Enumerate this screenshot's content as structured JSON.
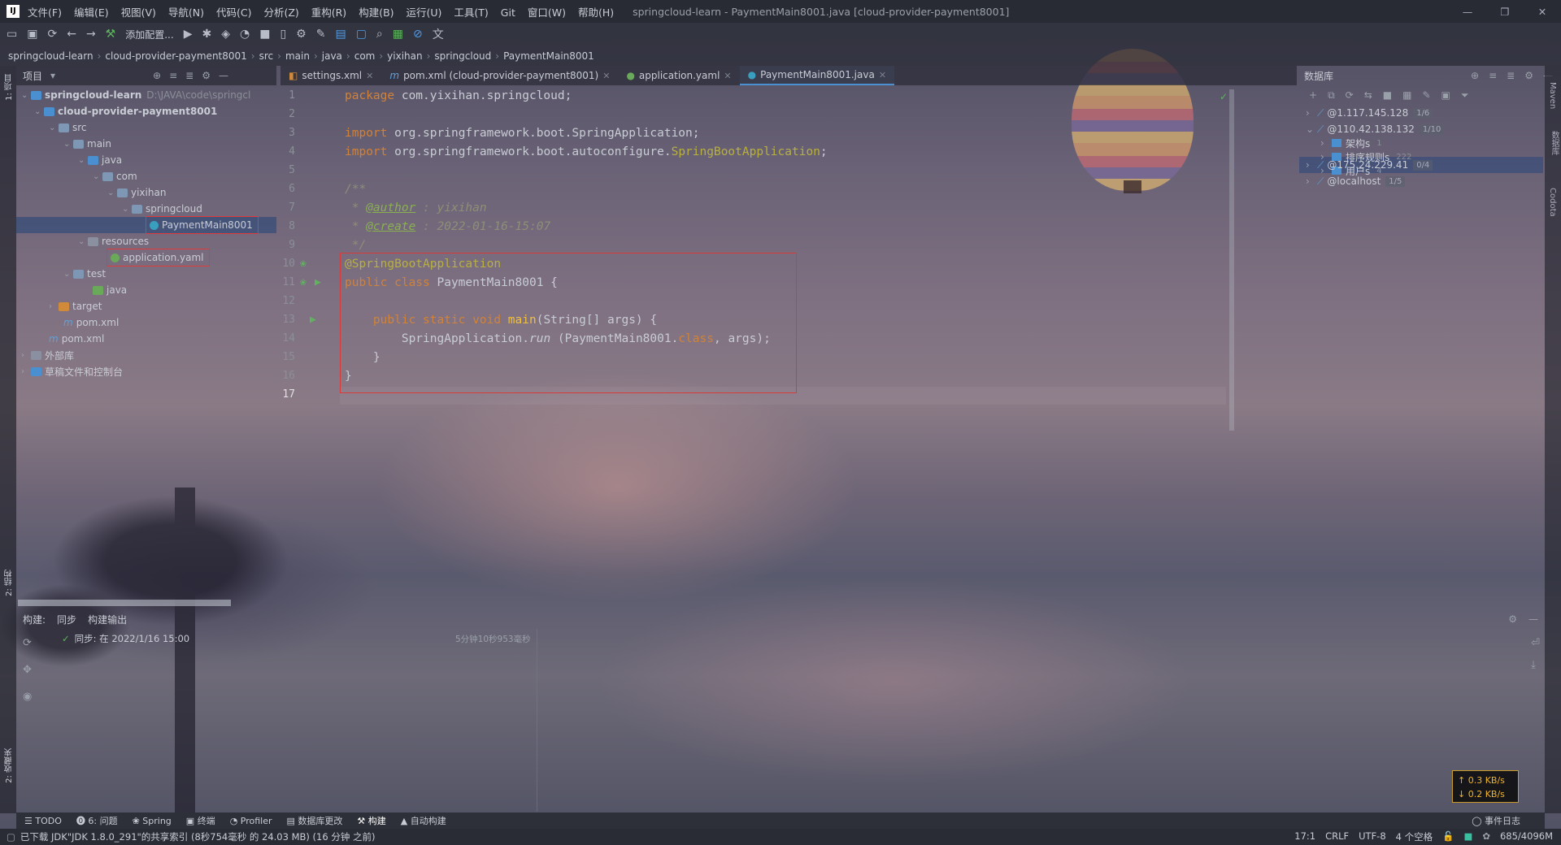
{
  "app": {
    "logo": "IJ",
    "menu": [
      "文件(F)",
      "编辑(E)",
      "视图(V)",
      "导航(N)",
      "代码(C)",
      "分析(Z)",
      "重构(R)",
      "构建(B)",
      "运行(U)",
      "工具(T)",
      "Git",
      "窗口(W)",
      "帮助(H)"
    ],
    "window_title": "springcloud-learn - PaymentMain8001.java [cloud-provider-payment8001]"
  },
  "toolbar": {
    "config_label": "添加配置..."
  },
  "breadcrumb": [
    "springcloud-learn",
    "cloud-provider-payment8001",
    "src",
    "main",
    "java",
    "com",
    "yixihan",
    "springcloud",
    "PaymentMain8001"
  ],
  "project": {
    "title": "项目",
    "tree": [
      {
        "label": "springcloud-learn",
        "path": "D:\\JAVA\\code\\springcl",
        "bold": true
      },
      {
        "label": "cloud-provider-payment8001",
        "bold": true
      },
      {
        "label": "src"
      },
      {
        "label": "main"
      },
      {
        "label": "java"
      },
      {
        "label": "com"
      },
      {
        "label": "yixihan"
      },
      {
        "label": "springcloud"
      },
      {
        "label": "PaymentMain8001"
      },
      {
        "label": "resources"
      },
      {
        "label": "application.yaml"
      },
      {
        "label": "test"
      },
      {
        "label": "java"
      },
      {
        "label": "target"
      },
      {
        "label": "pom.xml"
      },
      {
        "label": "pom.xml"
      },
      {
        "label": "外部库"
      },
      {
        "label": "草稿文件和控制台"
      }
    ]
  },
  "tabs": [
    {
      "label": "settings.xml"
    },
    {
      "label": "pom.xml (cloud-provider-payment8001)"
    },
    {
      "label": "application.yaml"
    },
    {
      "label": "PaymentMain8001.java",
      "active": true
    }
  ],
  "editor": {
    "line_numbers": [
      "1",
      "2",
      "3",
      "4",
      "5",
      "6",
      "7",
      "8",
      "9",
      "10",
      "11",
      "12",
      "13",
      "14",
      "15",
      "16",
      "17"
    ],
    "code": {
      "l1_kw": "package",
      "l1_rest": " com.yixihan.springcloud;",
      "l3_kw": "import",
      "l3_rest": " org.springframework.boot.SpringApplication;",
      "l4_kw": "import",
      "l4_rest": " org.springframework.boot.autoconfigure.",
      "l4_cls": "SpringBootApplication",
      "l4_end": ";",
      "l6": "/**",
      "l7_pre": " * ",
      "l7_tag": "@author",
      "l7_rest": " : yixihan",
      "l8_pre": " * ",
      "l8_tag": "@create",
      "l8_rest": " : 2022-01-16-15:07",
      "l9": " */",
      "l10": "@SpringBootApplication",
      "l11_kw": "public class",
      "l11_rest": " PaymentMain8001 {",
      "l13_ind": "    ",
      "l13_kw": "public static void",
      "l13_fn": " main",
      "l13_rest": "(String[] args) {",
      "l14_ind": "        ",
      "l14_a": "SpringApplication.",
      "l14_run": "run",
      "l14_b": " (PaymentMain8001.",
      "l14_cls": "class",
      "l14_c": ", args);",
      "l15": "    }",
      "l16": "}"
    }
  },
  "database": {
    "title": "数据库",
    "items": [
      {
        "label": "@1.117.145.128",
        "count": "1/6"
      },
      {
        "label": "@110.42.138.132",
        "count": "1/10"
      },
      {
        "label": "架构s",
        "n": "1"
      },
      {
        "label": "排序规则s",
        "n": "222"
      },
      {
        "label": "用户s",
        "n": "4"
      },
      {
        "label": "@175.24.229.41",
        "count": "0/4"
      },
      {
        "label": "@localhost",
        "count": "1/5"
      }
    ]
  },
  "build": {
    "title": "构建:",
    "tabs": [
      "同步",
      "构建输出"
    ],
    "entry": "同步: 在 2022/1/16 15:00",
    "duration": "5分钟10秒953毫秒"
  },
  "network": {
    "up": "↑ 0.3 KB/s",
    "down": "↓ 0.2 KB/s"
  },
  "bottom_tabs": [
    "TODO",
    "6: 问题",
    "Spring",
    "终端",
    "Profiler",
    "数据库更改",
    "构建",
    "自动构建"
  ],
  "left_strip": [
    "1: 项目",
    "2: 结构",
    "2: 收藏夹"
  ],
  "right_strip": [
    "Maven",
    "数据库",
    "Codota"
  ],
  "status": {
    "message": "已下载 JDK\"JDK 1.8.0_291\"的共享索引 (8秒754毫秒 的 24.03 MB) (16 分钟 之前)",
    "position": "17:1",
    "line_sep": "CRLF",
    "encoding": "UTF-8",
    "indent": "4 个空格",
    "memory": "685/4096M",
    "event_log": "事件日志"
  }
}
